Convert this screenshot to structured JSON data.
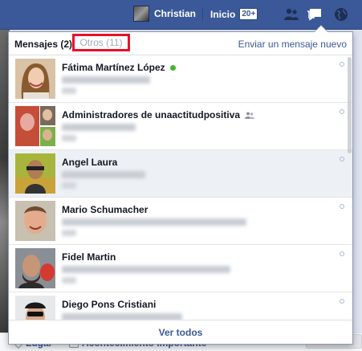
{
  "topbar": {
    "user_name": "Christian",
    "home_label": "Inicio",
    "home_badge": "20+"
  },
  "messages_dropdown": {
    "tab_messages": "Mensajes (2)",
    "tab_other": "Otros (11)",
    "new_message_link": "Enviar un mensaje nuevo",
    "see_all": "Ver todos",
    "conversations": [
      {
        "sender": "Fátima Martínez López",
        "online": true,
        "group": false,
        "unread": false
      },
      {
        "sender": "Administradores de unaactitudpositiva",
        "online": false,
        "group": true,
        "unread": false
      },
      {
        "sender": "Angel Laura",
        "online": false,
        "group": false,
        "unread": true
      },
      {
        "sender": "Mario Schumacher",
        "online": false,
        "group": false,
        "unread": false
      },
      {
        "sender": "Fidel Martin",
        "online": false,
        "group": false,
        "unread": false
      },
      {
        "sender": "Diego Pons Cristiani",
        "online": false,
        "group": false,
        "unread": false
      }
    ]
  },
  "background": {
    "footer_place": "Lugar",
    "footer_event": "Acontecimiento importante"
  },
  "icons": {
    "friends": "friend-requests-icon",
    "messages": "messages-icon",
    "notifications": "globe-icon"
  },
  "colors": {
    "brand_blue": "#3b5998",
    "highlight_red": "#e8102a",
    "online_green": "#42b72a"
  }
}
